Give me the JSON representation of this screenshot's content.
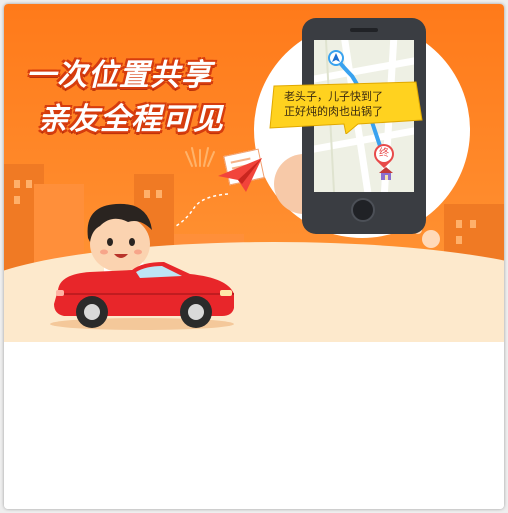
{
  "banner": {
    "headline_line1": "一次位置共享",
    "headline_line2": "亲友全程可见",
    "speech_line1": "老头子，儿子快到了",
    "speech_line2": "正好炖的肉也出锅了",
    "map_pin_label": "终"
  },
  "colors": {
    "banner_orange": "#ff7a1a",
    "ground_cream": "#fde9cc",
    "car_red": "#e8262a",
    "headline_outline": "#d63c0e",
    "speech_yellow": "#ffd21f"
  },
  "icons": [
    "navigation-arrow-icon",
    "destination-pin-icon",
    "paper-plane-icon",
    "house-icon"
  ]
}
